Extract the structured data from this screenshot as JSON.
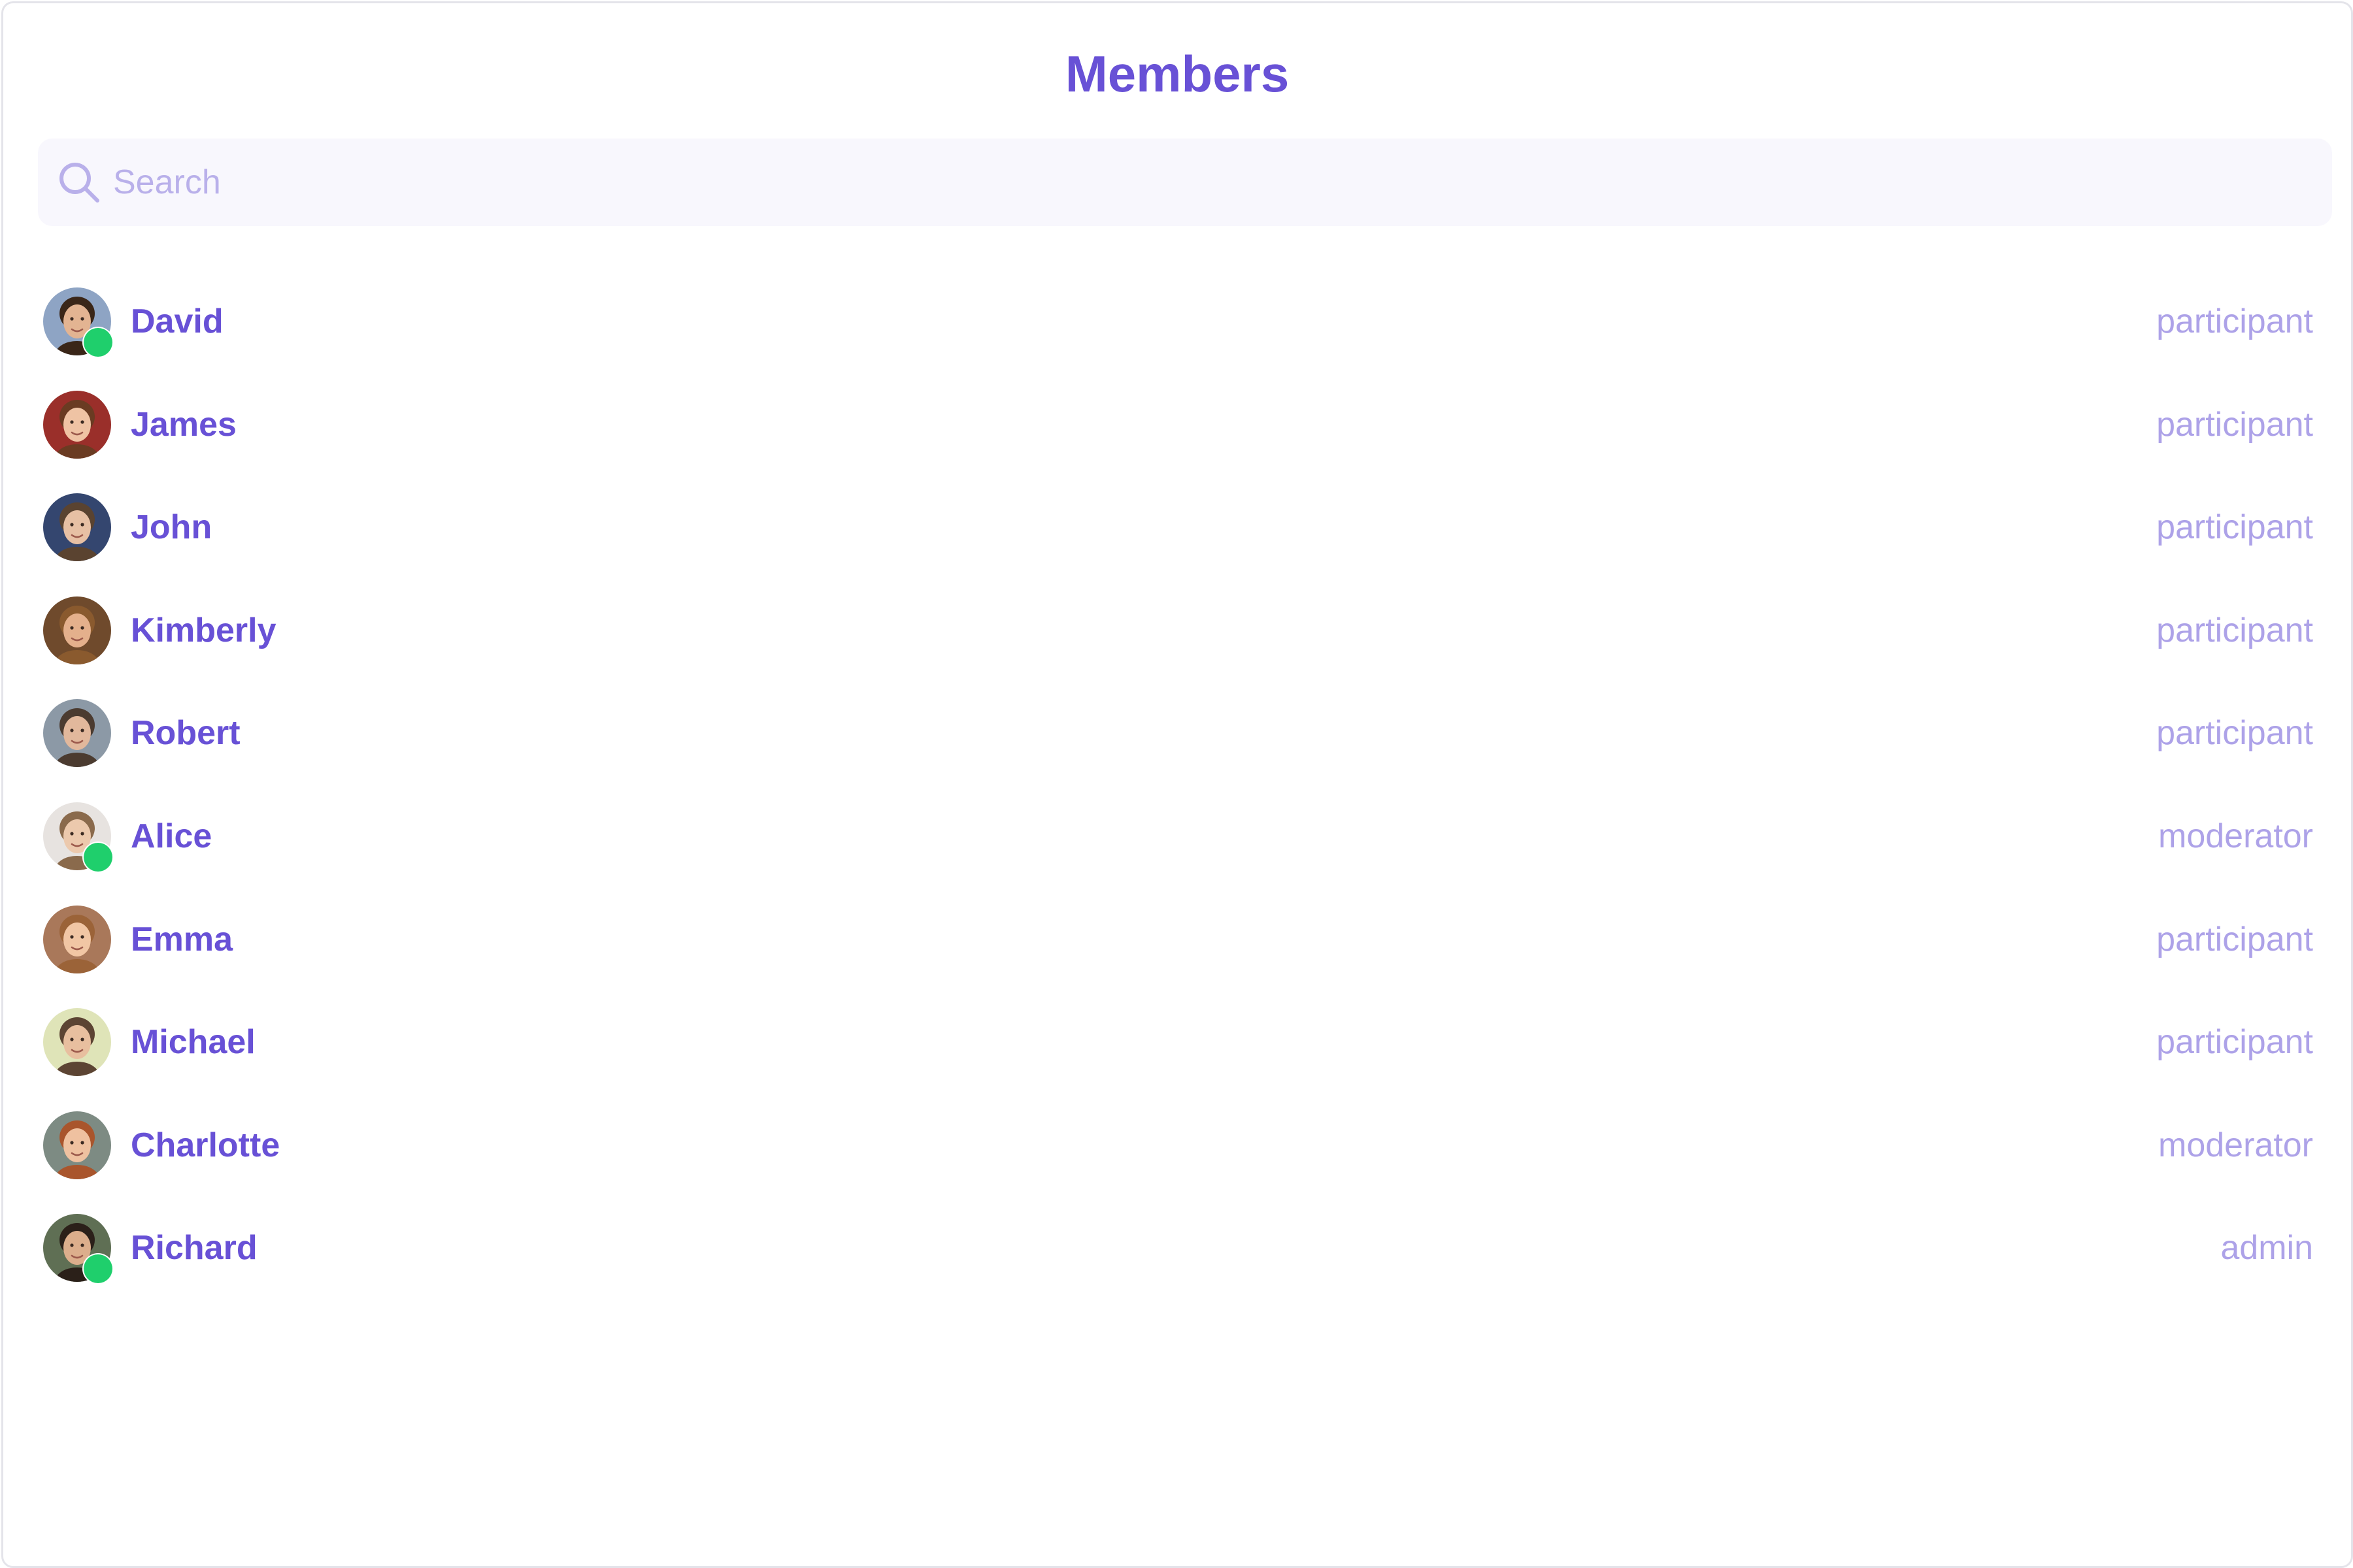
{
  "header": {
    "title": "Members"
  },
  "search": {
    "placeholder": "Search",
    "value": "",
    "icon": "search-icon"
  },
  "colors": {
    "accent": "#6851d6",
    "muted_text": "#ada2e8",
    "search_bg": "#f8f7fd",
    "online": "#1fcf6c"
  },
  "members": [
    {
      "name": "David",
      "role": "participant",
      "online": true,
      "avatar": {
        "bg": "#8ea4c4",
        "skin": "#e3b492",
        "hair": "#3a2618"
      }
    },
    {
      "name": "James",
      "role": "participant",
      "online": false,
      "avatar": {
        "bg": "#9a2f2a",
        "skin": "#efc3a4",
        "hair": "#6a3b22"
      }
    },
    {
      "name": "John",
      "role": "participant",
      "online": false,
      "avatar": {
        "bg": "#34466f",
        "skin": "#e7c0a4",
        "hair": "#5a4330"
      }
    },
    {
      "name": "Kimberly",
      "role": "participant",
      "online": false,
      "avatar": {
        "bg": "#6f4a2c",
        "skin": "#e4b08c",
        "hair": "#8a5a2e"
      }
    },
    {
      "name": "Robert",
      "role": "participant",
      "online": false,
      "avatar": {
        "bg": "#8c99a6",
        "skin": "#e2b89c",
        "hair": "#4b3b30"
      }
    },
    {
      "name": "Alice",
      "role": "moderator",
      "online": true,
      "avatar": {
        "bg": "#e7e3e0",
        "skin": "#ecc9ad",
        "hair": "#8a6a4c"
      }
    },
    {
      "name": "Emma",
      "role": "participant",
      "online": false,
      "avatar": {
        "bg": "#a9785a",
        "skin": "#f1c6a4",
        "hair": "#9b6338"
      }
    },
    {
      "name": "Michael",
      "role": "participant",
      "online": false,
      "avatar": {
        "bg": "#dfe4b8",
        "skin": "#e8bf9f",
        "hair": "#5c4433"
      }
    },
    {
      "name": "Charlotte",
      "role": "moderator",
      "online": false,
      "avatar": {
        "bg": "#7d8b83",
        "skin": "#efc1a0",
        "hair": "#a9552c"
      }
    },
    {
      "name": "Richard",
      "role": "admin",
      "online": true,
      "avatar": {
        "bg": "#5f6f54",
        "skin": "#dcae8c",
        "hair": "#2b2019"
      }
    }
  ]
}
